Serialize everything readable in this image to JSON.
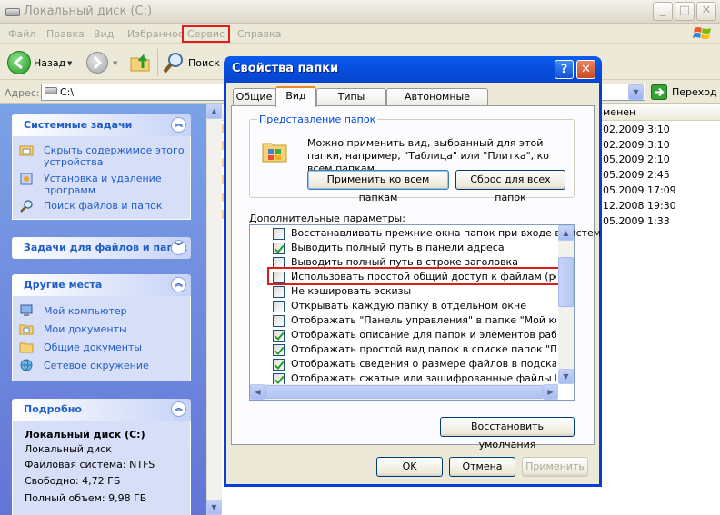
{
  "explorer": {
    "title": "Локальный диск (C:)",
    "caption_buttons": {
      "minimize": "_",
      "maximize": "□",
      "close": "✕"
    },
    "menu": [
      "Файл",
      "Правка",
      "Вид",
      "Избранное",
      "Сервис",
      "Справка"
    ],
    "toolbar": {
      "back_label": "Назад",
      "search_label": "Поиск"
    },
    "address": {
      "label": "Адрес:",
      "value": "C:\\",
      "go_label": "Переход"
    },
    "tasks_panel": {
      "title": "Системные задачи",
      "toggle": "︽",
      "items": [
        "Скрыть содержимое этого\nустройства",
        "Установка и удаление\nпрограмм",
        "Поиск файлов и папок"
      ]
    },
    "file_tasks_panel": {
      "title": "Задачи для файлов и папок",
      "toggle": "︾"
    },
    "places_panel": {
      "title": "Другие места",
      "toggle": "︽",
      "items": [
        "Мой компьютер",
        "Мои документы",
        "Общие документы",
        "Сетевое окружение"
      ]
    },
    "details_panel": {
      "title": "Подробно",
      "toggle": "︽",
      "name": "Локальный диск (C:)",
      "type": "Локальный диск",
      "fs": "Файловая система: NTFS",
      "free": "Свободно: 4,72 ГБ",
      "total": "Полный объем: 9,98 ГБ"
    },
    "file_list": {
      "column_header": "менен",
      "dates": [
        "02.2009 3:10",
        "02.2009 3:10",
        "05.2009 2:10",
        "05.2009 2:45",
        "05.2009 17:09",
        "12.2008 19:30",
        "05.2009 1:33"
      ]
    }
  },
  "dialog": {
    "title": "Свойства папки",
    "help_button": "?",
    "close_button": "✕",
    "tabs": [
      "Общие",
      "Вид",
      "Типы файлов",
      "Автономные файлы"
    ],
    "active_tab": "Вид",
    "group": {
      "label": "Представление папок",
      "text": "Можно применить вид, выбранный для этой папки, например, \"Таблица\" или \"Плитка\", ко всем папкам.",
      "apply_all": "Применить ко всем папкам",
      "reset_all": "Сброс для всех папок"
    },
    "advanced_label": "Дополнительные параметры:",
    "advanced_items": [
      {
        "text": "Восстанавливать прежние окна папок при входе в систем",
        "checked": false
      },
      {
        "text": "Выводить полный путь в панели адреса",
        "checked": true
      },
      {
        "text": "Выводить полный путь в строке заголовка",
        "checked": false
      },
      {
        "text": "Использовать простой общий доступ к файлам (рекоменд",
        "checked": false
      },
      {
        "text": "Не кэшировать эскизы",
        "checked": false
      },
      {
        "text": "Открывать каждую папку в отдельном окне",
        "checked": false
      },
      {
        "text": "Отображать \"Панель управления\" в папке \"Мой компьют",
        "checked": false
      },
      {
        "text": "Отображать описание для папок и элементов рабочего ст",
        "checked": true
      },
      {
        "text": "Отображать простой вид папок в списке папок \"Проводни",
        "checked": true
      },
      {
        "text": "Отображать сведения о размере файлов в подсказках па",
        "checked": true
      },
      {
        "text": "Отображать сжатые или зашифрованные файлы NTFS дру",
        "checked": true
      }
    ],
    "restore_defaults": "Восстановить умолчания",
    "ok": "OK",
    "cancel": "Отмена",
    "apply": "Применить"
  },
  "colors": {
    "highlight_frame": "#e01c1c",
    "xp_blue": "#0a5ef0",
    "task_link": "#215dc6"
  }
}
